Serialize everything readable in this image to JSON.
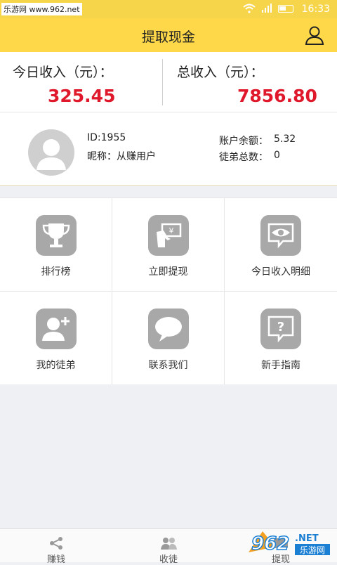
{
  "status": {
    "watermark": "乐游网 www.962.net",
    "time": "16:33"
  },
  "appbar": {
    "title": "提取现金",
    "user_icon": "user-icon"
  },
  "income": {
    "today_label": "今日收入（元）：",
    "today_value": "325.45",
    "total_label": "总收入（元）：",
    "total_value": "7856.80",
    "value_color": "#e0182b"
  },
  "profile": {
    "id": "ID:1955",
    "nickname": "昵称：从赚用户",
    "balance_label": "账户余额：",
    "balance_value": "5.32",
    "apprentice_label": "徒弟总数：",
    "apprentice_value": "0"
  },
  "grid": [
    {
      "label": "排行榜",
      "icon": "trophy-icon"
    },
    {
      "label": "立即提现",
      "icon": "cash-hand-icon"
    },
    {
      "label": "今日收入明细",
      "icon": "eye-chat-icon"
    },
    {
      "label": "我的徒弟",
      "icon": "add-user-icon"
    },
    {
      "label": "联系我们",
      "icon": "chat-bubble-icon"
    },
    {
      "label": "新手指南",
      "icon": "help-icon"
    }
  ],
  "tabs": [
    {
      "label": "赚钱",
      "icon": "share-icon"
    },
    {
      "label": "收徒",
      "icon": "group-icon"
    },
    {
      "label": "提现",
      "icon": "wallet-icon"
    }
  ],
  "watermark_logo": {
    "brand": "962",
    "suffix": ".NET",
    "site": "乐游网"
  },
  "colors": {
    "accent": "#ffd84a",
    "icon_bg": "#a8a8a8"
  }
}
